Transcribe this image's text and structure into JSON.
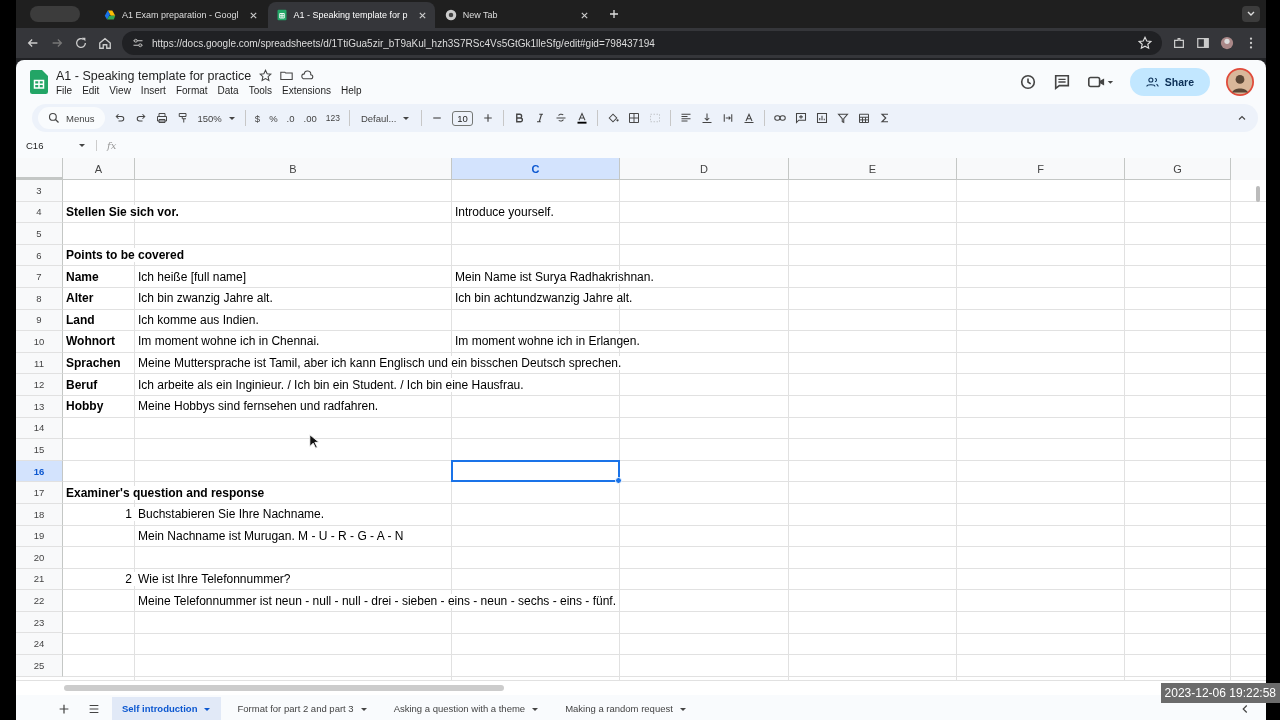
{
  "browser_tabs": [
    {
      "label": "A1 Exam preparation - Googl",
      "selected": false,
      "kind": "drive"
    },
    {
      "label": "A1 - Speaking template for p",
      "selected": true,
      "kind": "sheets"
    },
    {
      "label": "New Tab",
      "selected": false,
      "kind": "chrome"
    }
  ],
  "url": "https://docs.google.com/spreadsheets/d/1TtiGua5zir_bT9aKul_hzh3S7RSc4Vs5GtGk1lleSfg/edit#gid=798437194",
  "doc_title": "A1 - Speaking template for practice",
  "menu": [
    "File",
    "Edit",
    "View",
    "Insert",
    "Format",
    "Data",
    "Tools",
    "Extensions",
    "Help"
  ],
  "share_label": "Share",
  "toolbar": {
    "search": "Menus",
    "zoom": "150%",
    "currency": "$",
    "percent": "%",
    "dec_less": ".0",
    "dec_more": ".00",
    "number_format": "123",
    "font": "Defaul...",
    "font_size": "10"
  },
  "name_box": "C16",
  "fx": "fx",
  "columns": [
    {
      "label": "A",
      "selected": false
    },
    {
      "label": "B",
      "selected": false
    },
    {
      "label": "C",
      "selected": true
    },
    {
      "label": "D",
      "selected": false
    },
    {
      "label": "E",
      "selected": false
    },
    {
      "label": "F",
      "selected": false
    },
    {
      "label": "G",
      "selected": false
    }
  ],
  "rows": [
    {
      "n": "3",
      "selected": false
    },
    {
      "n": "4",
      "selected": false,
      "kind": "bold",
      "a": "Stellen Sie sich vor.",
      "c": "Introduce yourself."
    },
    {
      "n": "5",
      "selected": false
    },
    {
      "n": "6",
      "selected": false,
      "kind": "bold",
      "a": "Points to be covered"
    },
    {
      "n": "7",
      "selected": false,
      "kind": "bold",
      "a": "Name",
      "b": "Ich heiße [full name]",
      "c": "Mein Name ist Surya Radhakrishnan."
    },
    {
      "n": "8",
      "selected": false,
      "kind": "bold",
      "a": "Alter",
      "b": "Ich bin zwanzig Jahre alt.",
      "c": "Ich bin achtundzwanzig Jahre alt."
    },
    {
      "n": "9",
      "selected": false,
      "kind": "bold",
      "a": "Land",
      "b": "Ich komme aus Indien."
    },
    {
      "n": "10",
      "selected": false,
      "kind": "bold",
      "a": "Wohnort",
      "b": "Im moment wohne ich in Chennai.",
      "c": "Im moment wohne ich in Erlangen."
    },
    {
      "n": "11",
      "selected": false,
      "kind": "bold",
      "a": "Sprachen",
      "b": "Meine Muttersprache ist Tamil, aber ich kann Englisch und ein bisschen Deutsch sprechen."
    },
    {
      "n": "12",
      "selected": false,
      "kind": "bold",
      "a": "Beruf",
      "b": "Ich arbeite als ein Inginieur. / Ich bin ein Student. / Ich bin eine Hausfrau."
    },
    {
      "n": "13",
      "selected": false,
      "kind": "bold",
      "a": "Hobby",
      "b": "Meine Hobbys sind fernsehen und radfahren."
    },
    {
      "n": "14",
      "selected": false
    },
    {
      "n": "15",
      "selected": false
    },
    {
      "n": "16",
      "selected": true
    },
    {
      "n": "17",
      "selected": false,
      "kind": "bold",
      "a": "Examiner's question and response"
    },
    {
      "n": "18",
      "selected": false,
      "kind": "number",
      "a": "1",
      "b": "Buchstabieren Sie Ihre Nachname."
    },
    {
      "n": "19",
      "selected": false,
      "b": "Mein Nachname ist Murugan. M - U - R  - G - A - N"
    },
    {
      "n": "20",
      "selected": false
    },
    {
      "n": "21",
      "selected": false,
      "kind": "number",
      "a": "2",
      "b": "Wie ist Ihre Telefonnummer?"
    },
    {
      "n": "22",
      "selected": false,
      "b": "Meine Telefonnummer ist neun - null - null - drei - sieben - eins - neun - sechs - eins - fünf."
    },
    {
      "n": "23",
      "selected": false
    },
    {
      "n": "24",
      "selected": false
    },
    {
      "n": "25",
      "selected": false
    }
  ],
  "sheet_tabs": [
    {
      "label": "Self introduction",
      "selected": true
    },
    {
      "label": "Format for part 2 and part 3",
      "selected": false
    },
    {
      "label": "Asking a question with a theme",
      "selected": false
    },
    {
      "label": "Making a random request",
      "selected": false
    }
  ],
  "timestamp": "2023-12-06 19:22:58"
}
